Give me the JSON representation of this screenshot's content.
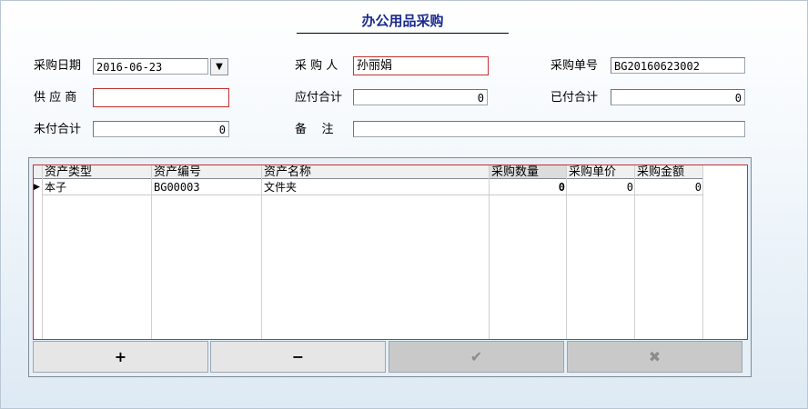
{
  "title": "办公用品采购",
  "form": {
    "date_label": "采购日期",
    "date_value": "2016-06-23",
    "purchaser_label": "采 购 人",
    "purchaser_value": "孙丽娟",
    "order_no_label": "采购单号",
    "order_no_value": "BG20160623002",
    "supplier_label": "供 应 商",
    "supplier_value": "",
    "payable_label": "应付合计",
    "payable_value": "0",
    "paid_label": "已付合计",
    "paid_value": "0",
    "unpaid_label": "未付合计",
    "unpaid_value": "0",
    "remark_label": "备    注",
    "remark_value": ""
  },
  "grid": {
    "columns": [
      "资产类型",
      "资产编号",
      "资产名称",
      "采购数量",
      "采购单价",
      "采购金额"
    ],
    "rows": [
      [
        "本子",
        "BG00003",
        "文件夹",
        "0",
        "0",
        "0"
      ]
    ]
  },
  "buttons": {
    "add": "+",
    "remove": "−",
    "confirm": "✔",
    "cancel": "✖"
  }
}
